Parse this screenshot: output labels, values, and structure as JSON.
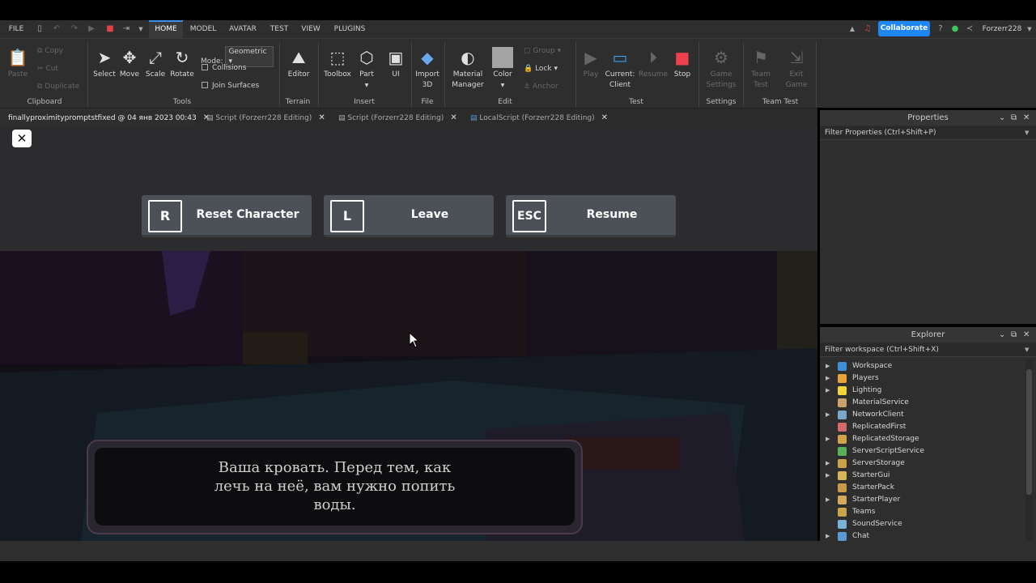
{
  "menubar": {
    "file": "FILE",
    "tabs": [
      "HOME",
      "MODEL",
      "AVATAR",
      "TEST",
      "VIEW",
      "PLUGINS"
    ],
    "collaborate": "Collaborate",
    "username": "Forzerr228"
  },
  "ribbon": {
    "clipboard": {
      "paste": "Paste",
      "copy": "Copy",
      "cut": "Cut",
      "duplicate": "Duplicate",
      "label": "Clipboard"
    },
    "tools": {
      "select": "Select",
      "move": "Move",
      "scale": "Scale",
      "rotate": "Rotate",
      "mode_label": "Mode:",
      "mode_value": "Geometric",
      "collisions": "Collisions",
      "join_surfaces": "Join Surfaces",
      "label": "Tools"
    },
    "terrain": {
      "editor": "Editor",
      "label": "Terrain"
    },
    "insert": {
      "toolbox": "Toolbox",
      "part": "Part",
      "ui": "UI",
      "label": "Insert"
    },
    "file": {
      "import3d_1": "Import",
      "import3d_2": "3D",
      "label": "File"
    },
    "edit": {
      "material_1": "Material",
      "material_2": "Manager",
      "color": "Color",
      "group": "Group",
      "lock": "Lock",
      "anchor": "Anchor",
      "label": "Edit"
    },
    "test": {
      "play": "Play",
      "current_1": "Current:",
      "current_2": "Client",
      "resume": "Resume",
      "stop": "Stop",
      "label": "Test"
    },
    "settings": {
      "game_1": "Game",
      "game_2": "Settings",
      "label": "Settings"
    },
    "team_test": {
      "team_1": "Team",
      "team_2": "Test",
      "exit_1": "Exit",
      "exit_2": "Game",
      "label": "Team Test"
    }
  },
  "doc_tabs": [
    "finallyproximitypromptstfixed @ 04 янв 2023 00:43",
    "Script (Forzerr228 Editing)",
    "Script (Forzerr228 Editing)",
    "LocalScript (Forzerr228 Editing)"
  ],
  "game_menu": {
    "buttons": [
      {
        "key": "R",
        "label": "Reset Character"
      },
      {
        "key": "L",
        "label": "Leave"
      },
      {
        "key": "ESC",
        "label": "Resume"
      }
    ]
  },
  "dialog": {
    "text": "Ваша кровать. Перед тем, как лечь на неё, вам нужно попить воды."
  },
  "properties": {
    "title": "Properties",
    "filter": "Filter Properties (Ctrl+Shift+P)"
  },
  "explorer": {
    "title": "Explorer",
    "filter": "Filter workspace (Ctrl+Shift+X)",
    "items": [
      {
        "name": "Workspace",
        "arrow": true,
        "color": "#3f8fd6"
      },
      {
        "name": "Players",
        "arrow": true,
        "color": "#e8a23a"
      },
      {
        "name": "Lighting",
        "arrow": true,
        "color": "#f2d43a"
      },
      {
        "name": "MaterialService",
        "arrow": false,
        "color": "#c9a46a"
      },
      {
        "name": "NetworkClient",
        "arrow": true,
        "color": "#7aa7c9"
      },
      {
        "name": "ReplicatedFirst",
        "arrow": false,
        "color": "#d46a6a"
      },
      {
        "name": "ReplicatedStorage",
        "arrow": true,
        "color": "#d4a24a"
      },
      {
        "name": "ServerScriptService",
        "arrow": false,
        "color": "#5ab05a"
      },
      {
        "name": "ServerStorage",
        "arrow": true,
        "color": "#c9a24a"
      },
      {
        "name": "StarterGui",
        "arrow": true,
        "color": "#d4b45a"
      },
      {
        "name": "StarterPack",
        "arrow": false,
        "color": "#c99a4a"
      },
      {
        "name": "StarterPlayer",
        "arrow": true,
        "color": "#d4aa5a"
      },
      {
        "name": "Teams",
        "arrow": false,
        "color": "#c9a44a"
      },
      {
        "name": "SoundService",
        "arrow": false,
        "color": "#7ab0d4"
      },
      {
        "name": "Chat",
        "arrow": true,
        "color": "#5a9ad4"
      }
    ]
  }
}
